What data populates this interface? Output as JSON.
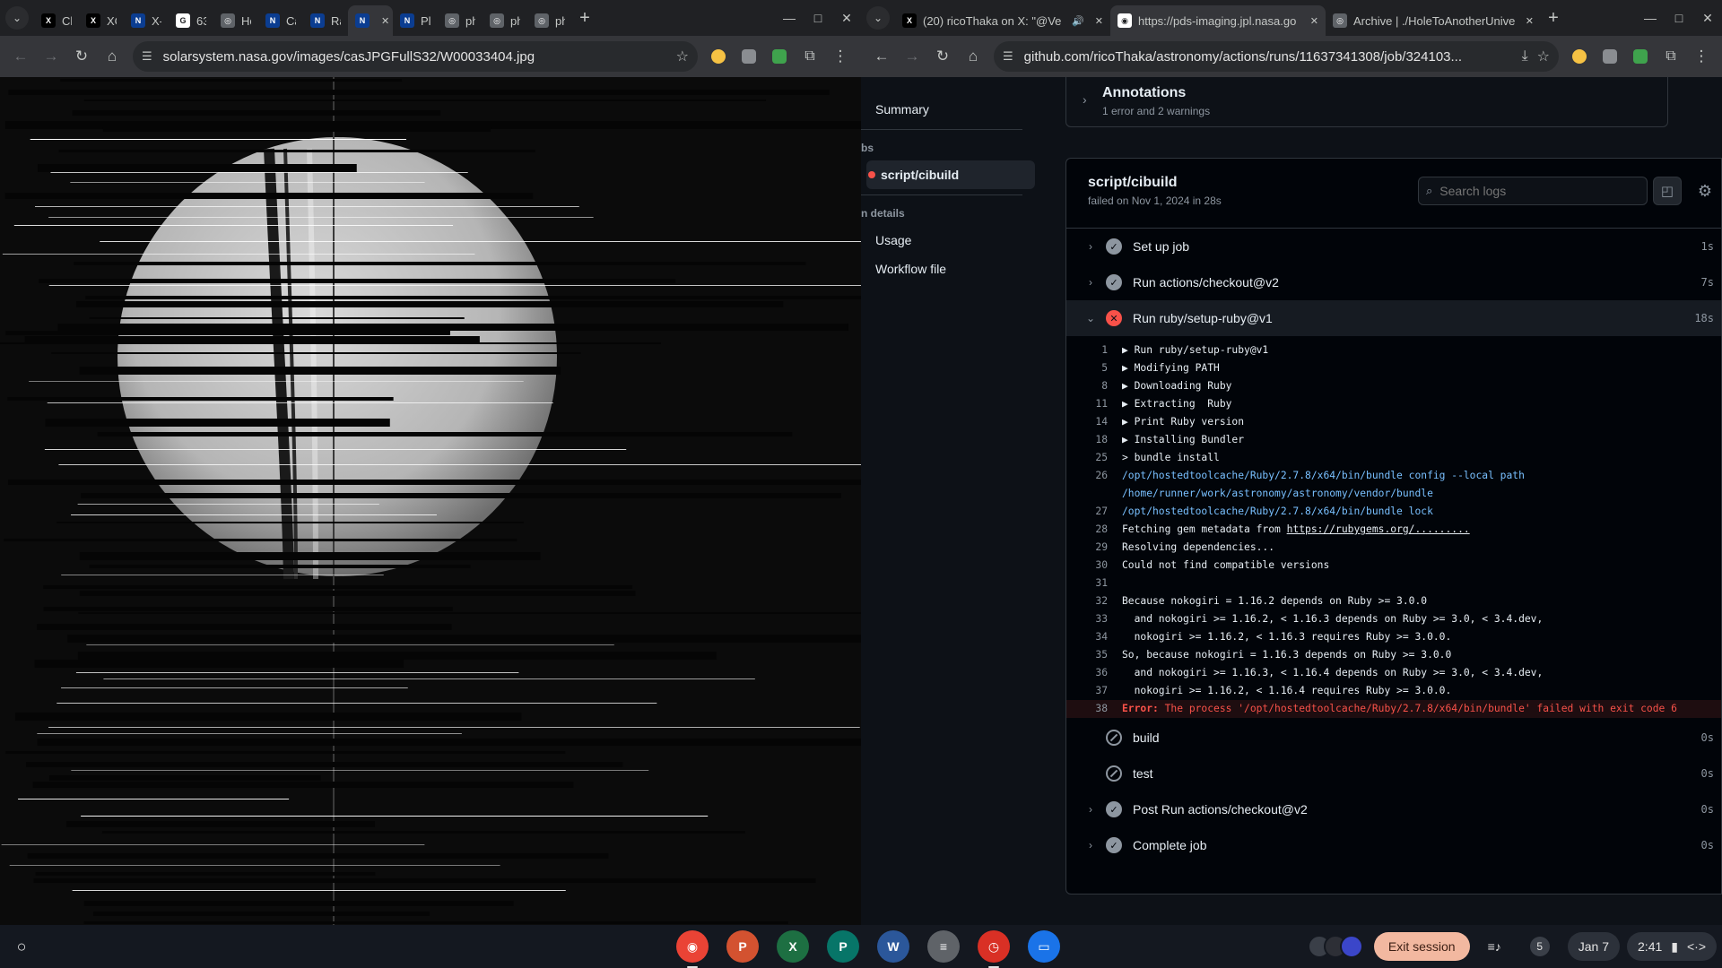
{
  "left_window": {
    "tabs": [
      {
        "title": "Ch",
        "icon": "x-logo-icon"
      },
      {
        "title": "XC",
        "icon": "x-logo-icon"
      },
      {
        "title": "X-S",
        "icon": "nasa-icon"
      },
      {
        "title": "63",
        "icon": "google-icon"
      },
      {
        "title": "Ho",
        "icon": "globe-icon"
      },
      {
        "title": "Ca",
        "icon": "nasa-icon"
      },
      {
        "title": "Ra",
        "icon": "nasa-icon"
      },
      {
        "title": "",
        "icon": "nasa-icon",
        "active": true
      },
      {
        "title": "Pl/",
        "icon": "nasa-icon"
      },
      {
        "title": "ph",
        "icon": "globe-icon"
      },
      {
        "title": "ph",
        "icon": "globe-icon"
      },
      {
        "title": "ph",
        "icon": "globe-icon"
      }
    ],
    "url": "solarsystem.nasa.gov/images/casJPGFullS32/W00033404.jpg"
  },
  "right_window": {
    "tabs": [
      {
        "title": "(20) ricoThaka on X: \"@Ve",
        "icon": "x-logo-icon",
        "audio": true
      },
      {
        "title": "https://pds-imaging.jpl.nasa.go",
        "icon": "github-icon",
        "active": true
      },
      {
        "title": "Archive | ./HoleToAnotherUnive",
        "icon": "globe-icon"
      }
    ],
    "url": "github.com/ricoThaka/astronomy/actions/runs/11637341308/job/324103..."
  },
  "sidebar": {
    "summary": "Summary",
    "jobs_caption": "bs",
    "job_item": "script/cibuild",
    "run_details_caption": "n details",
    "usage": "Usage",
    "workflow_file": "Workflow file"
  },
  "annotations": {
    "title": "Annotations",
    "subtitle": "1 error and 2 warnings"
  },
  "job": {
    "title": "script/cibuild",
    "subtitle": "failed on Nov 1, 2024 in 28s",
    "search_placeholder": "Search logs"
  },
  "steps_before": [
    {
      "name": "Set up job",
      "status": "success",
      "duration": "1s"
    },
    {
      "name": "Run actions/checkout@v2",
      "status": "success",
      "duration": "7s"
    }
  ],
  "open_step": {
    "name": "Run ruby/setup-ruby@v1",
    "status": "failure",
    "duration": "18s"
  },
  "log_lines": [
    {
      "n": "1",
      "text": "▶ Run ruby/setup-ruby@v1",
      "kind": "normal"
    },
    {
      "n": "5",
      "text": "▶ Modifying PATH",
      "kind": "normal"
    },
    {
      "n": "8",
      "text": "▶ Downloading Ruby",
      "kind": "normal"
    },
    {
      "n": "11",
      "text": "▶ Extracting  Ruby",
      "kind": "normal"
    },
    {
      "n": "14",
      "text": "▶ Print Ruby version",
      "kind": "normal"
    },
    {
      "n": "18",
      "text": "▶ Installing Bundler",
      "kind": "normal"
    },
    {
      "n": "25",
      "text": "> bundle install",
      "kind": "normal"
    },
    {
      "n": "26",
      "text": "/opt/hostedtoolcache/Ruby/2.7.8/x64/bin/bundle config --local path",
      "kind": "path"
    },
    {
      "n": "",
      "text": "/home/runner/work/astronomy/astronomy/vendor/bundle",
      "kind": "path"
    },
    {
      "n": "27",
      "text": "/opt/hostedtoolcache/Ruby/2.7.8/x64/bin/bundle lock",
      "kind": "path"
    },
    {
      "n": "28",
      "text": "Fetching gem metadata from ",
      "link": "https://rubygems.org/.........",
      "kind": "link"
    },
    {
      "n": "29",
      "text": "Resolving dependencies...",
      "kind": "normal"
    },
    {
      "n": "30",
      "text": "Could not find compatible versions",
      "kind": "normal"
    },
    {
      "n": "31",
      "text": "",
      "kind": "normal"
    },
    {
      "n": "32",
      "text": "Because nokogiri = 1.16.2 depends on Ruby >= 3.0.0",
      "kind": "normal"
    },
    {
      "n": "33",
      "text": "  and nokogiri >= 1.16.2, < 1.16.3 depends on Ruby >= 3.0, < 3.4.dev,",
      "kind": "normal"
    },
    {
      "n": "34",
      "text": "  nokogiri >= 1.16.2, < 1.16.3 requires Ruby >= 3.0.0.",
      "kind": "normal"
    },
    {
      "n": "35",
      "text": "So, because nokogiri = 1.16.3 depends on Ruby >= 3.0.0",
      "kind": "normal"
    },
    {
      "n": "36",
      "text": "  and nokogiri >= 1.16.3, < 1.16.4 depends on Ruby >= 3.0, < 3.4.dev,",
      "kind": "normal"
    },
    {
      "n": "37",
      "text": "  nokogiri >= 1.16.2, < 1.16.4 requires Ruby >= 3.0.0.",
      "kind": "normal"
    },
    {
      "n": "38",
      "label": "Error:",
      "text": " The process '/opt/hostedtoolcache/Ruby/2.7.8/x64/bin/bundle' failed with exit code 6",
      "kind": "error"
    }
  ],
  "steps_after": [
    {
      "name": "build",
      "status": "skipped",
      "duration": "0s"
    },
    {
      "name": "test",
      "status": "skipped",
      "duration": "0s"
    },
    {
      "name": "Post Run actions/checkout@v2",
      "status": "success",
      "duration": "0s"
    },
    {
      "name": "Complete job",
      "status": "success",
      "duration": "0s"
    }
  ],
  "shelf": {
    "apps": [
      {
        "name": "chrome-app",
        "color": "#ea4335",
        "glyph": "◉",
        "active": true
      },
      {
        "name": "powerpoint-app",
        "color": "#d35230",
        "glyph": "P"
      },
      {
        "name": "excel-app",
        "color": "#1d6f42",
        "glyph": "X"
      },
      {
        "name": "publisher-app",
        "color": "#077568",
        "glyph": "P"
      },
      {
        "name": "word-app",
        "color": "#2b579a",
        "glyph": "W"
      },
      {
        "name": "docs-app",
        "color": "#5f6368",
        "glyph": "≡"
      },
      {
        "name": "timer-app",
        "color": "#d93025",
        "glyph": "◷",
        "active": true
      },
      {
        "name": "files-app",
        "color": "#1a73e8",
        "glyph": "▭"
      }
    ],
    "exit_label": "Exit session",
    "notification_count": "5",
    "date": "Jan 7",
    "time": "2:41"
  }
}
